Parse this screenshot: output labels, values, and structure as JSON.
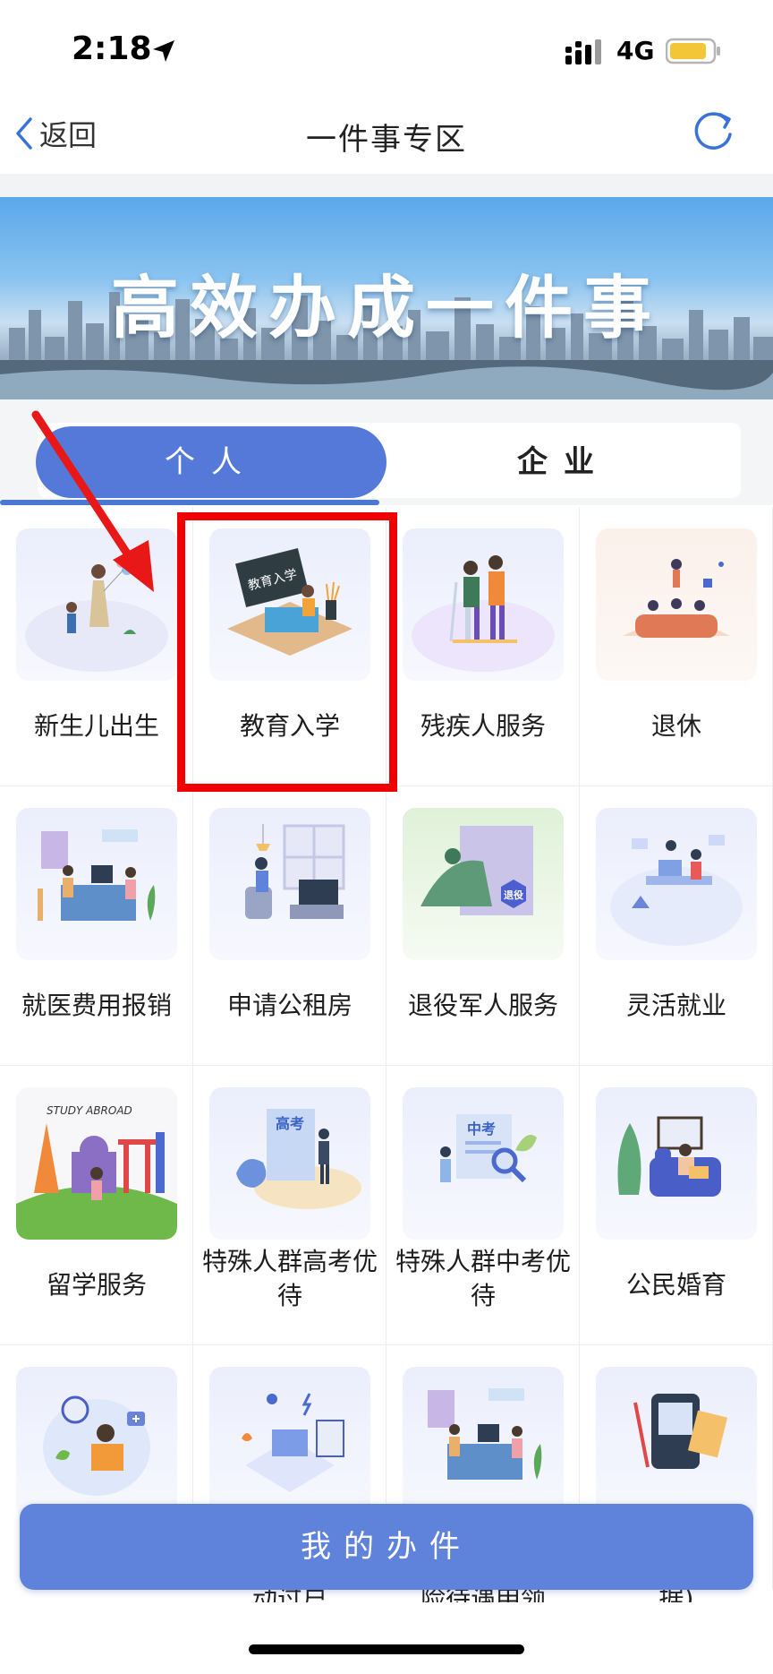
{
  "status_bar": {
    "time": "2:18",
    "network": "4G"
  },
  "nav": {
    "back_label": "返回",
    "title": "一件事专区"
  },
  "banner": {
    "headline": "高效办成一件事"
  },
  "tabs": [
    {
      "label": "个人",
      "selected": true
    },
    {
      "label": "企业",
      "selected": false
    }
  ],
  "items": [
    {
      "label": "新生儿出生",
      "icon": "newborn-icon"
    },
    {
      "label": "教育入学",
      "icon": "education-enrollment-icon",
      "badge": "教育入学",
      "highlighted": true
    },
    {
      "label": "残疾人服务",
      "icon": "disability-service-icon"
    },
    {
      "label": "退休",
      "icon": "retirement-icon"
    },
    {
      "label": "就医费用报销",
      "icon": "medical-reimbursement-icon"
    },
    {
      "label": "申请公租房",
      "icon": "public-housing-icon"
    },
    {
      "label": "退役军人服务",
      "icon": "veteran-service-icon",
      "badge": "退役"
    },
    {
      "label": "灵活就业",
      "icon": "flexible-employment-icon"
    },
    {
      "label": "留学服务",
      "icon": "study-abroad-icon",
      "badge": "STUDY ABROAD"
    },
    {
      "label": "特殊人群高考优待",
      "icon": "gaokao-icon",
      "badge": "高考"
    },
    {
      "label": "特殊人群中考优待",
      "icon": "zhongkao-icon",
      "badge": "中考"
    },
    {
      "label": "公民婚育",
      "icon": "marriage-childbirth-icon"
    },
    {
      "label": "",
      "icon": "telehealth-icon"
    },
    {
      "label": "",
      "icon": "online-service-icon"
    },
    {
      "label": "",
      "icon": "office-service-icon"
    },
    {
      "label": "",
      "icon": "medical-record-icon"
    }
  ],
  "cut_labels": [
    "",
    "动过户",
    "险待遇申领",
    "据)"
  ],
  "bottom_button": {
    "label": "我的办件"
  },
  "colors": {
    "primary": "#5479d8",
    "button": "#5f82db",
    "highlight": "#f00000"
  }
}
